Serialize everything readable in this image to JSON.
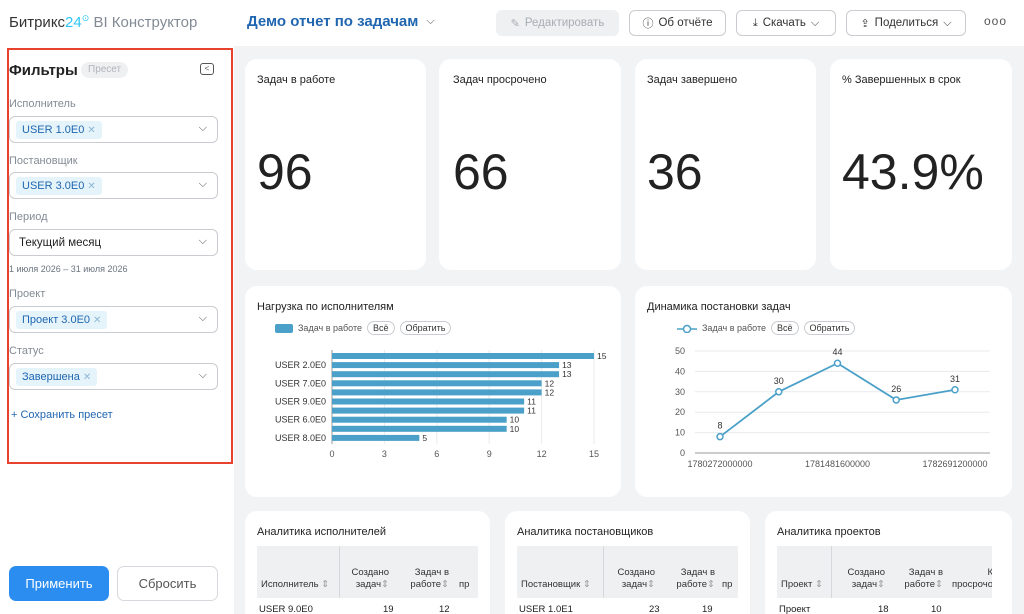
{
  "header": {
    "logo_main": "Битрикс",
    "logo_num": "24",
    "logo_product": "BI Конструктор",
    "report_title": "Демо отчет по задачам",
    "buttons": {
      "edit": "Редактировать",
      "about": "Об отчёте",
      "download": "Скачать",
      "share": "Поделиться"
    },
    "more": "ooo"
  },
  "sidebar": {
    "title": "Фильтры",
    "preset_badge": "Пресет",
    "filters": {
      "assignee_label": "Исполнитель",
      "assignee_chip": "USER 1.0E0",
      "creator_label": "Постановщик",
      "creator_chip": "USER 3.0E0",
      "period_label": "Период",
      "period_value": "Текущий месяц",
      "period_hint": "1 июля 2026 – 31 июля 2026",
      "project_label": "Проект",
      "project_chip": "Проект 3.0E0",
      "status_label": "Статус",
      "status_chip": "Завершена"
    },
    "save_preset": "+ Сохранить пресет",
    "apply": "Применить",
    "reset": "Сбросить"
  },
  "kpis": [
    {
      "title": "Задач в работе",
      "value": "96"
    },
    {
      "title": "Задач просрочено",
      "value": "66"
    },
    {
      "title": "Задач завершено",
      "value": "36"
    },
    {
      "title": "% Завершенных в срок",
      "value": "43.9%"
    }
  ],
  "legend_common": {
    "all": "Всё",
    "invert": "Обратить"
  },
  "colors": {
    "accent": "#2b8def",
    "series": "#4aa0c8",
    "highlight": "#e8412f"
  },
  "chart_data": [
    {
      "type": "bar",
      "orientation": "horizontal",
      "title": "Нагрузка по исполнителям",
      "series_name": "Задач в работе",
      "categories": [
        "",
        "USER 2.0E0",
        "",
        "USER 7.0E0",
        "",
        "USER 9.0E0",
        "",
        "USER 6.0E0",
        "",
        "USER 8.0E0"
      ],
      "values": [
        15,
        13,
        13,
        12,
        12,
        11,
        11,
        10,
        10,
        5
      ],
      "xticks": [
        "0",
        "3",
        "6",
        "9",
        "12",
        "15"
      ],
      "xlim": [
        0,
        15
      ]
    },
    {
      "type": "line",
      "title": "Динамика постановки задач",
      "series_name": "Задач в работе",
      "x": [
        1780272000000,
        1780876800000,
        1781481600000,
        1782086400000,
        1782691200000
      ],
      "values": [
        8,
        30,
        44,
        26,
        31
      ],
      "xticks": [
        "1780272000000",
        "1781481600000",
        "1782691200000"
      ],
      "yticks": [
        "0",
        "10",
        "20",
        "30",
        "40",
        "50"
      ],
      "ylim": [
        0,
        50
      ]
    }
  ],
  "tables": [
    {
      "title": "Аналитика исполнителей",
      "col1": "Исполнитель",
      "col2a": "Создано",
      "col2b": "задач",
      "col3a": "Задач в",
      "col3b": "работе",
      "col4": "пр",
      "row": [
        "USER 9.0E0",
        "19",
        "12"
      ]
    },
    {
      "title": "Аналитика постановщиков",
      "col1": "Постановщик",
      "col2a": "Создано",
      "col2b": "задач",
      "col3a": "Задач в",
      "col3b": "работе",
      "col4": "пр",
      "row": [
        "USER 1.0E1",
        "23",
        "19"
      ]
    },
    {
      "title": "Аналитика проектов",
      "col1": "Проект",
      "col2a": "Создано",
      "col2b": "задач",
      "col3a": "Задач в",
      "col3b": "работе",
      "col4a": "К",
      "col4b": "просрочо",
      "row": [
        "Проект",
        "18",
        "10"
      ]
    }
  ]
}
